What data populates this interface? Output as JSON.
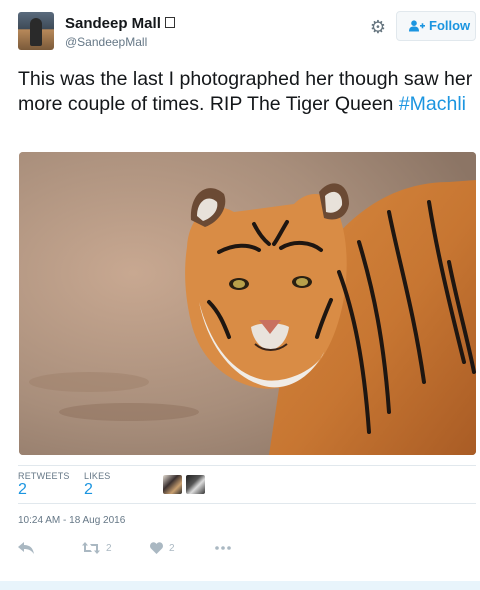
{
  "tweet": {
    "author": {
      "name": "Sandeep Mall",
      "handle": "@SandeepMall"
    },
    "follow_label": "Follow",
    "text_before": "This was the last I photographed her though saw her more couple of times. RIP The Tiger Queen",
    "hashtag": "#Machli",
    "media": {
      "description_icon": "tiger-photo"
    },
    "stats": {
      "retweets_label": "RETWEETS",
      "retweets_value": "2",
      "likes_label": "LIKES",
      "likes_value": "2"
    },
    "timestamp": "10:24 AM - 18 Aug 2016",
    "actions": {
      "reply_icon": "reply-icon",
      "retweet_icon": "retweet-icon",
      "retweet_count": "2",
      "like_icon": "heart-icon",
      "like_count": "2",
      "more_icon": "more-icon"
    }
  },
  "colors": {
    "accent": "#1b95e0",
    "muted": "#657786",
    "icon_muted": "#aab8c2",
    "border": "#e1e8ed"
  }
}
